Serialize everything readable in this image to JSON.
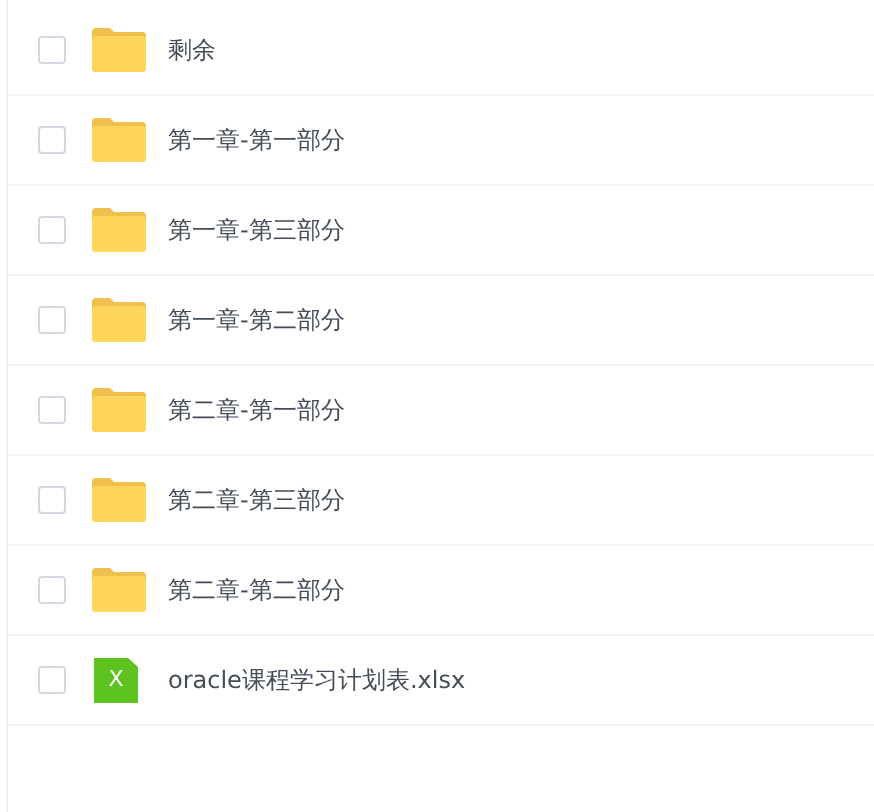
{
  "files": [
    {
      "kind": "folder",
      "name": "剩余",
      "checked": false
    },
    {
      "kind": "folder",
      "name": "第一章-第一部分",
      "checked": false
    },
    {
      "kind": "folder",
      "name": "第一章-第三部分",
      "checked": false
    },
    {
      "kind": "folder",
      "name": "第一章-第二部分",
      "checked": false
    },
    {
      "kind": "folder",
      "name": "第二章-第一部分",
      "checked": false
    },
    {
      "kind": "folder",
      "name": "第二章-第三部分",
      "checked": false
    },
    {
      "kind": "folder",
      "name": "第二章-第二部分",
      "checked": false
    },
    {
      "kind": "excel",
      "name": "oracle课程学习计划表.xlsx",
      "icon_letter": "X",
      "checked": false
    }
  ]
}
